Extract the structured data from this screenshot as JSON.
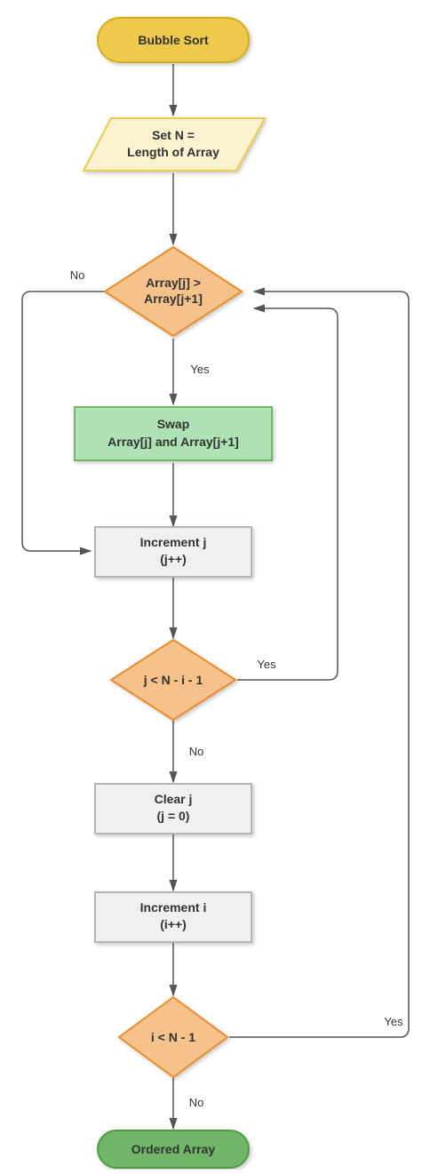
{
  "title": "Bubble Sort",
  "nodes": {
    "start": "Bubble Sort",
    "setN_l1": "Set N =",
    "setN_l2": "Length of Array",
    "cmp_l1": "Array[j] >",
    "cmp_l2": "Array[j+1]",
    "swap_l1": "Swap",
    "swap_l2": "Array[j] and Array[j+1]",
    "incJ_l1": "Increment j",
    "incJ_l2": "(j++)",
    "jcond": "j < N - i - 1",
    "clearJ_l1": "Clear j",
    "clearJ_l2": "(j = 0)",
    "incI_l1": "Increment i",
    "incI_l2": "(i++)",
    "icond": "i < N - 1",
    "end": "Ordered Array"
  },
  "labels": {
    "yes": "Yes",
    "no": "No"
  },
  "colors": {
    "terminatorStartFill": "#efc94c",
    "terminatorStartStroke": "#d3ac22",
    "terminatorEndFill": "#71b668",
    "terminatorEndStroke": "#4e9c45",
    "ioFill": "#fcf2cf",
    "ioStroke": "#efc94c",
    "decisionFill": "#f6c28b",
    "decisionStroke": "#e88d2c",
    "processFill": "#f0f0f0",
    "processStroke": "#b5b5b5",
    "swapFill": "#aee1b3",
    "swapStroke": "#71b668",
    "edgeStroke": "#555555"
  },
  "chart_data": {
    "type": "flowchart",
    "title": "Bubble Sort",
    "nodes": [
      {
        "id": "start",
        "kind": "terminator",
        "label": "Bubble Sort"
      },
      {
        "id": "setN",
        "kind": "io",
        "label": "Set N = Length of Array"
      },
      {
        "id": "cmp",
        "kind": "decision",
        "label": "Array[j] > Array[j+1]"
      },
      {
        "id": "swap",
        "kind": "process",
        "label": "Swap Array[j] and Array[j+1]"
      },
      {
        "id": "incJ",
        "kind": "process",
        "label": "Increment j (j++)"
      },
      {
        "id": "jcond",
        "kind": "decision",
        "label": "j < N - i - 1"
      },
      {
        "id": "clearJ",
        "kind": "process",
        "label": "Clear j (j = 0)"
      },
      {
        "id": "incI",
        "kind": "process",
        "label": "Increment i (i++)"
      },
      {
        "id": "icond",
        "kind": "decision",
        "label": "i < N - 1"
      },
      {
        "id": "end",
        "kind": "terminator",
        "label": "Ordered Array"
      }
    ],
    "edges": [
      {
        "from": "start",
        "to": "setN"
      },
      {
        "from": "setN",
        "to": "cmp"
      },
      {
        "from": "cmp",
        "to": "swap",
        "label": "Yes"
      },
      {
        "from": "cmp",
        "to": "incJ",
        "label": "No"
      },
      {
        "from": "swap",
        "to": "incJ"
      },
      {
        "from": "incJ",
        "to": "jcond"
      },
      {
        "from": "jcond",
        "to": "cmp",
        "label": "Yes"
      },
      {
        "from": "jcond",
        "to": "clearJ",
        "label": "No"
      },
      {
        "from": "clearJ",
        "to": "incI"
      },
      {
        "from": "incI",
        "to": "icond"
      },
      {
        "from": "icond",
        "to": "cmp",
        "label": "Yes"
      },
      {
        "from": "icond",
        "to": "end",
        "label": "No"
      }
    ]
  }
}
